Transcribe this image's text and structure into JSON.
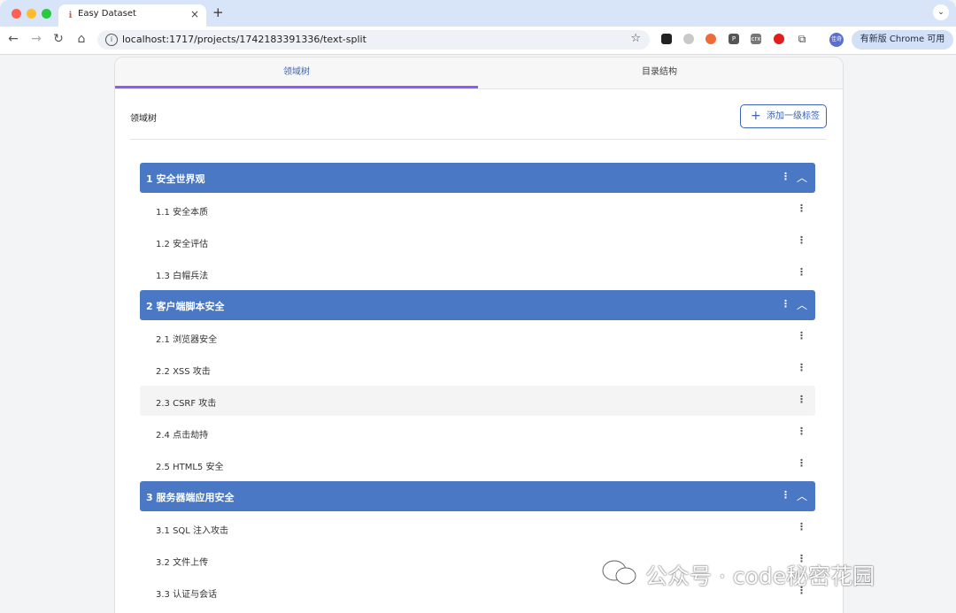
{
  "browser": {
    "tab_title": "Easy Dataset",
    "tab_close": "×",
    "new_tab": "+",
    "tab_menu": "⌄",
    "url": "localhost:1717/projects/1742183391336/text-split",
    "update_label": "有新版 Chrome 可用",
    "avatar_text": "佳奇",
    "ext_icons": [
      "tampermonkey-icon",
      "ext-gray-icon",
      "ext-orange-icon",
      "ext-p-icon",
      "ext-crx-icon",
      "ext-red-icon",
      "puzzle-icon"
    ]
  },
  "page": {
    "tabs": [
      {
        "label": "领域树",
        "active": true
      },
      {
        "label": "目录结构",
        "active": false
      }
    ],
    "section_title": "领域树",
    "add_button_label": "添加一级标签",
    "groups": [
      {
        "label": "1 安全世界观",
        "items": [
          "1.1 安全本质",
          "1.2 安全评估",
          "1.3 白帽兵法"
        ]
      },
      {
        "label": "2 客户端脚本安全",
        "items": [
          "2.1 浏览器安全",
          "2.2 XSS 攻击",
          "2.3 CSRF 攻击",
          "2.4 点击劫持",
          "2.5 HTML5 安全"
        ]
      },
      {
        "label": "3 服务器端应用安全",
        "items": [
          "3.1 SQL 注入攻击",
          "3.2 文件上传",
          "3.3 认证与会话"
        ]
      }
    ],
    "hovered_item": "2.3 CSRF 攻击"
  },
  "watermark": "公众号 · code秘密花园",
  "colors": {
    "accent": "#4a78c4",
    "tab_indicator": "#8b5cf6",
    "link": "#3c63b8"
  }
}
